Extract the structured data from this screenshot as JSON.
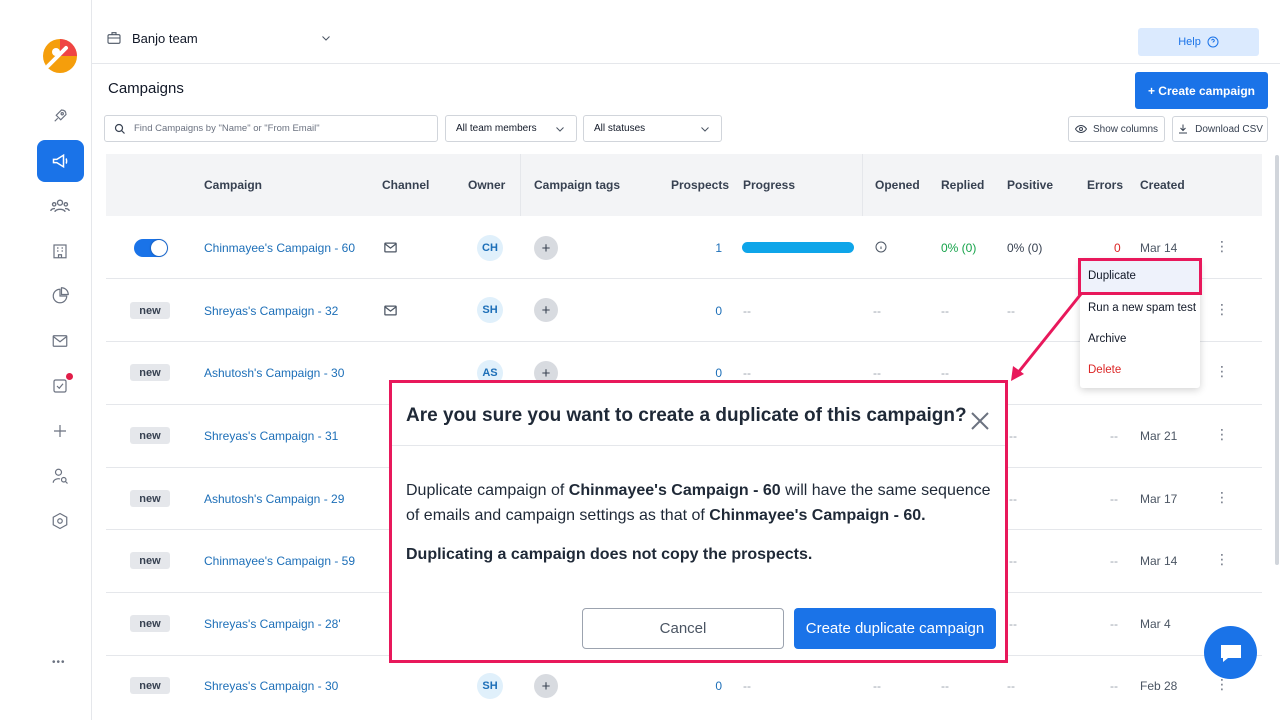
{
  "header": {
    "team": "Banjo team",
    "help": "Help"
  },
  "page": {
    "title": "Campaigns",
    "create_button": "+ Create campaign"
  },
  "filters": {
    "search_placeholder": "Find Campaigns by \"Name\" or \"From Email\"",
    "members": "All team members",
    "statuses": "All statuses",
    "show_columns": "Show columns",
    "download_csv": "Download CSV"
  },
  "table": {
    "columns": {
      "campaign": "Campaign",
      "channel": "Channel",
      "owner": "Owner",
      "tags": "Campaign tags",
      "prospects": "Prospects",
      "progress": "Progress",
      "opened": "Opened",
      "replied": "Replied",
      "positive": "Positive",
      "errors": "Errors",
      "created": "Created"
    },
    "rows": [
      {
        "status": "on",
        "name": "Chinmayee's Campaign - 60",
        "owner": "CH",
        "prospects": "1",
        "progress_fraction": 1.0,
        "opened": "",
        "replied": "0% (0)",
        "positive": "0% (0)",
        "errors": "0",
        "created": "Mar 14"
      },
      {
        "status": "new",
        "name": "Shreyas's Campaign - 32",
        "owner": "SH",
        "prospects": "0",
        "progress": "--",
        "opened": "--",
        "replied": "--",
        "positive": "--",
        "errors": "",
        "created": ""
      },
      {
        "status": "new",
        "name": "Ashutosh's Campaign - 30",
        "owner": "AS",
        "prospects": "0",
        "progress": "--",
        "opened": "--",
        "replied": "--",
        "positive": "",
        "errors": "",
        "created": ""
      },
      {
        "status": "new",
        "name": "Shreyas's Campaign - 31",
        "owner": "",
        "prospects": "",
        "progress": "",
        "opened": "",
        "replied": "",
        "positive": "--",
        "errors": "--",
        "created": "Mar 21"
      },
      {
        "status": "new",
        "name": "Ashutosh's Campaign - 29",
        "owner": "",
        "prospects": "",
        "progress": "",
        "opened": "",
        "replied": "",
        "positive": "--",
        "errors": "--",
        "created": "Mar 17"
      },
      {
        "status": "new",
        "name": "Chinmayee's Campaign - 59",
        "owner": "",
        "prospects": "",
        "progress": "",
        "opened": "",
        "replied": "",
        "positive": "--",
        "errors": "--",
        "created": "Mar 14"
      },
      {
        "status": "new",
        "name": "Shreyas's Campaign - 28'",
        "owner": "",
        "prospects": "",
        "progress": "",
        "opened": "",
        "replied": "",
        "positive": "--",
        "errors": "--",
        "created": "Mar 4"
      },
      {
        "status": "new",
        "name": "Shreyas's Campaign - 30",
        "owner": "SH",
        "prospects": "0",
        "progress": "--",
        "opened": "--",
        "replied": "--",
        "positive": "--",
        "errors": "--",
        "created": "Feb 28"
      }
    ],
    "new_badge": "new",
    "tag_add": "+"
  },
  "context_menu": {
    "items": [
      "Duplicate",
      "Run a new spam test",
      "Archive",
      "Delete"
    ],
    "delete_color": "#dc2626"
  },
  "modal": {
    "title": "Are you sure you want to create a duplicate of this campaign?",
    "body_prefix": "Duplicate campaign of ",
    "campaign_name": "Chinmayee's Campaign - 60",
    "body_middle": " will have the same sequence of emails and campaign settings as that of ",
    "campaign_name_2": "Chinmayee's Campaign - 60.",
    "note": "Duplicating a campaign does not copy the prospects.",
    "cancel": "Cancel",
    "confirm": "Create duplicate campaign"
  },
  "colors": {
    "accent": "#1a73e8",
    "highlight": "#e8185b",
    "link": "#1d6fb8",
    "success": "#16a34a",
    "error": "#dc2626"
  },
  "more": "•••"
}
